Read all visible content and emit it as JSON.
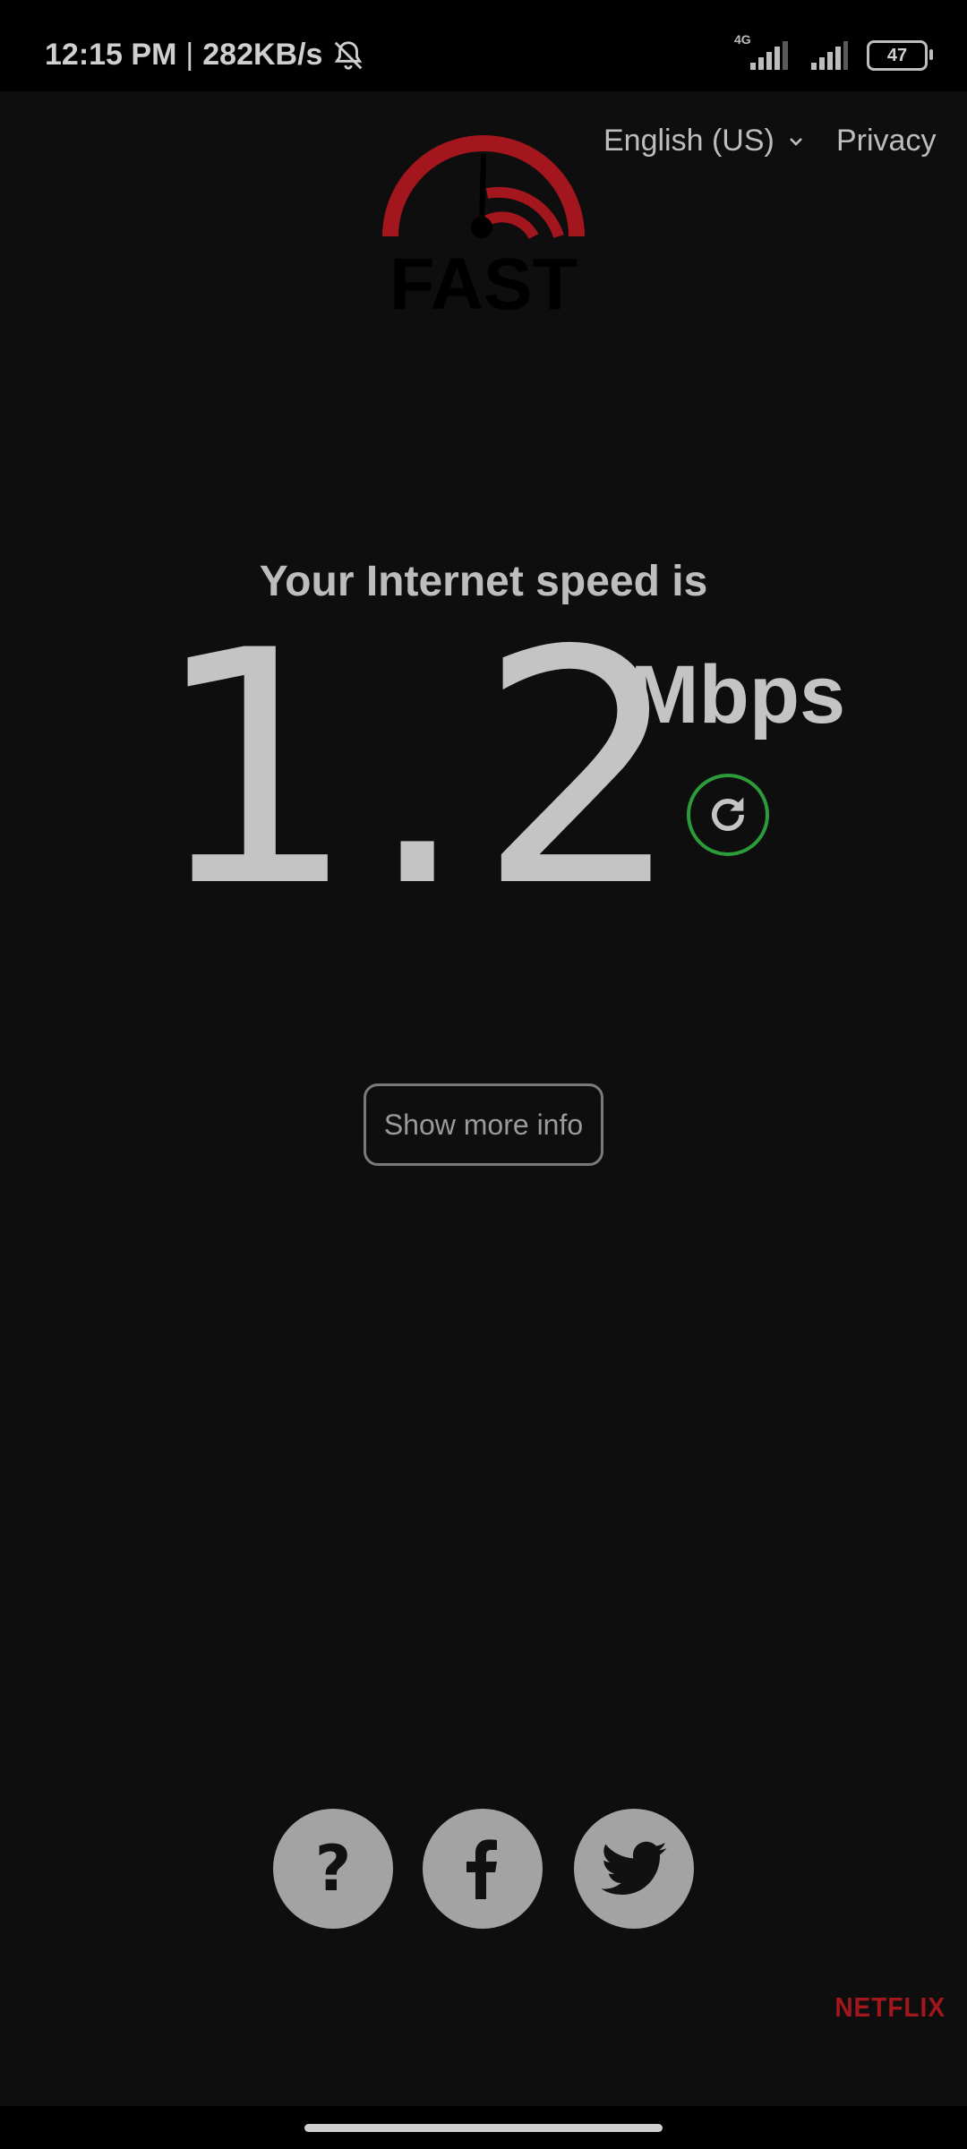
{
  "status_bar": {
    "time": "12:15 PM",
    "separator": "|",
    "net_speed": "282KB/s",
    "network_type": "4G",
    "battery": "47",
    "icons": [
      "bell-off-icon",
      "signal-icon",
      "signal-icon",
      "battery-icon"
    ]
  },
  "header": {
    "logo_text": "FAST",
    "language": "English (US)",
    "privacy": "Privacy"
  },
  "speed": {
    "caption": "Your Internet speed is",
    "value": "1.2",
    "unit": "Mbps"
  },
  "more_info_label": "Show more info",
  "footer": {
    "buttons": [
      "help-icon",
      "facebook-icon",
      "twitter-icon"
    ],
    "netflix": "NETFLIX"
  },
  "colors": {
    "background": "#0e0e0e",
    "accent_red": "#a4161d",
    "reload_green": "#2c9b3a",
    "text": "#bdbdbd"
  }
}
